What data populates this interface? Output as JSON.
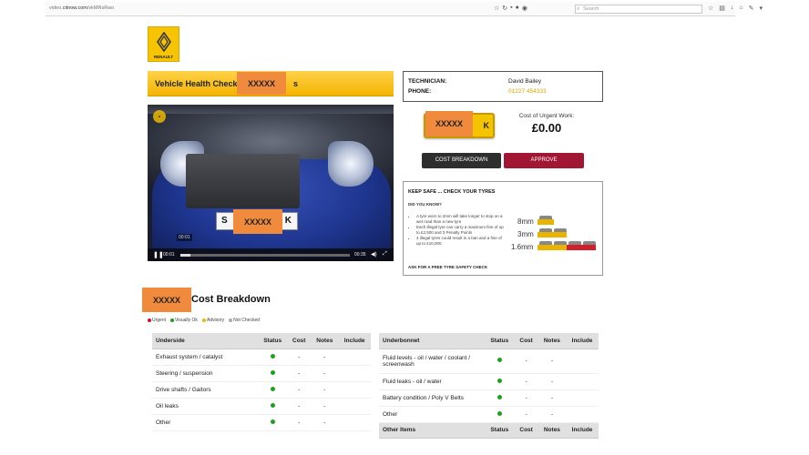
{
  "browser": {
    "url_prefix": "video.",
    "url_domain": "citnow.com",
    "url_path": "/vkMRsRwo",
    "search_placeholder": "Search"
  },
  "brand": {
    "name": "RENAULT",
    "color": "#f6c400"
  },
  "header": {
    "title": "Vehicle Health Check f",
    "title_tail": "s",
    "redacted": "XXXXX"
  },
  "video": {
    "timestamp_overlay": "00:01",
    "current_time": "00:01",
    "duration": "00:35",
    "progress": 0.06,
    "plate_left": "S",
    "plate_right": "K",
    "plate_redacted": "XXXXX"
  },
  "technician": {
    "tech_label": "TECHNICIAN:",
    "tech_value": "David Bailey",
    "phone_label": "PHONE:",
    "phone_value": "01227 454333"
  },
  "cost": {
    "plate_redacted": "XXXXX",
    "plate_right": "K",
    "label": "Cost of Urgent Work:",
    "value": "£0.00"
  },
  "buttons": {
    "breakdown": "COST BREAKDOWN",
    "approve": "APPROVE",
    "approve_color": "#a11632"
  },
  "tyres": {
    "heading": "KEEP SAFE ... CHECK YOUR TYRES",
    "did_you_know": "DID YOU KNOW?",
    "bullets": [
      "A tyre worn to 2mm will take longer to stop on a wet road than a new tyre",
      "Each illegal tyre can carry a maximum fine of up to £2,500 and 3 Penalty Points",
      "4 illegal tyres could result in a ban and a fine of up to £10,000"
    ],
    "depths": [
      "8mm",
      "3mm",
      "1.6mm"
    ],
    "ask": "ASK FOR A FREE TYRE SAFETY CHECK"
  },
  "breakdown": {
    "redacted": "XXXXX",
    "title": "Cost Breakdown",
    "legend": [
      {
        "label": "Urgent",
        "color": "#c8102e"
      },
      {
        "label": "Visually Ok",
        "color": "#1fa01f"
      },
      {
        "label": "Advisory",
        "color": "#f2b800"
      },
      {
        "label": "Not Checked",
        "color": "#aaaaaa"
      }
    ],
    "columns": [
      "Status",
      "Cost",
      "Notes",
      "Include"
    ],
    "underside": {
      "heading": "Underside",
      "rows": [
        {
          "item": "Exhaust system / catalyst",
          "cost": "-",
          "notes": "-"
        },
        {
          "item": "Steering / suspension",
          "cost": "-",
          "notes": "-"
        },
        {
          "item": "Drive shafts / Gaitors",
          "cost": "-",
          "notes": "-"
        },
        {
          "item": "Oil leaks",
          "cost": "-",
          "notes": "-"
        },
        {
          "item": "Other",
          "cost": "-",
          "notes": "-"
        }
      ]
    },
    "underbonnet": {
      "heading": "Underbonnet",
      "rows": [
        {
          "item": "Fluid levels - oil / water / coolant / screenwash",
          "cost": "-",
          "notes": "-"
        },
        {
          "item": "Fluid leaks - oil / water",
          "cost": "-",
          "notes": "-"
        },
        {
          "item": "Battery condition / Poly V Belts",
          "cost": "-",
          "notes": "-"
        },
        {
          "item": "Other",
          "cost": "-",
          "notes": "-"
        }
      ]
    },
    "other_items": {
      "heading": "Other Items"
    }
  }
}
